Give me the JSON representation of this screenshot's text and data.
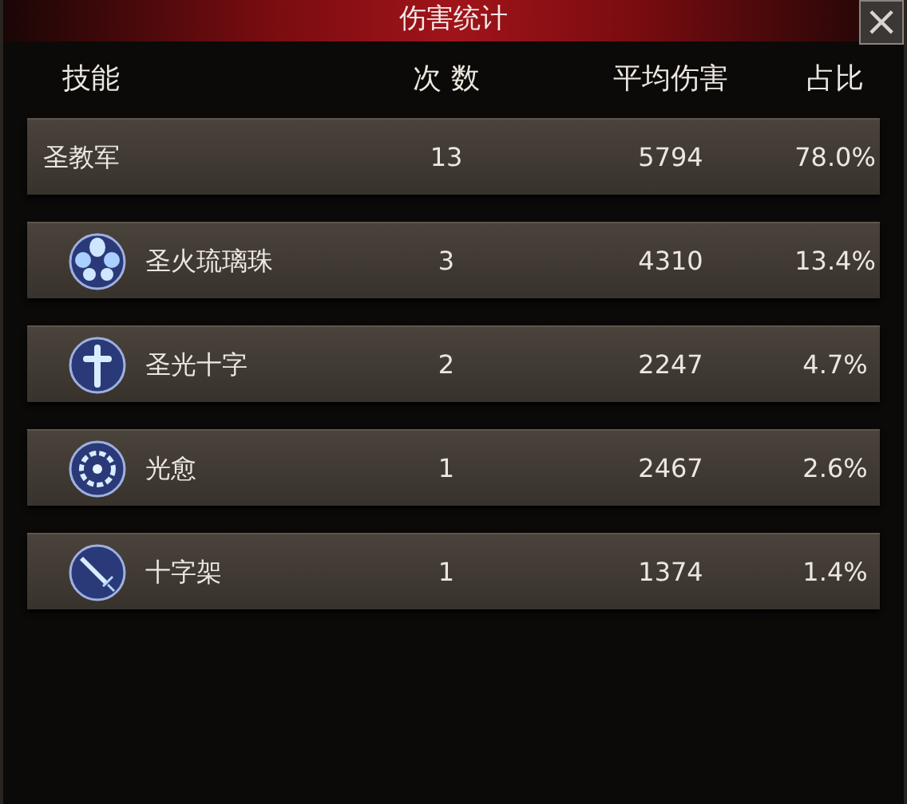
{
  "window": {
    "title": "伤害统计",
    "close": "×"
  },
  "table": {
    "columns": [
      "技能",
      "次 数",
      "平均伤害",
      "占比"
    ],
    "rows": [
      {
        "kind": "plain",
        "skill": "圣教军",
        "count": "13",
        "average": "5794",
        "share": "78.0%"
      },
      {
        "kind": "orbs",
        "skill": "圣火琉璃珠",
        "count": "3",
        "average": "4310",
        "share": "13.4%"
      },
      {
        "kind": "cross",
        "skill": "圣光十字",
        "count": "2",
        "average": "2247",
        "share": "4.7%"
      },
      {
        "kind": "ring",
        "skill": "光愈",
        "count": "1",
        "average": "2467",
        "share": "2.6%"
      },
      {
        "kind": "sword",
        "skill": "十字架",
        "count": "1",
        "average": "1374",
        "share": "1.4%"
      }
    ]
  }
}
